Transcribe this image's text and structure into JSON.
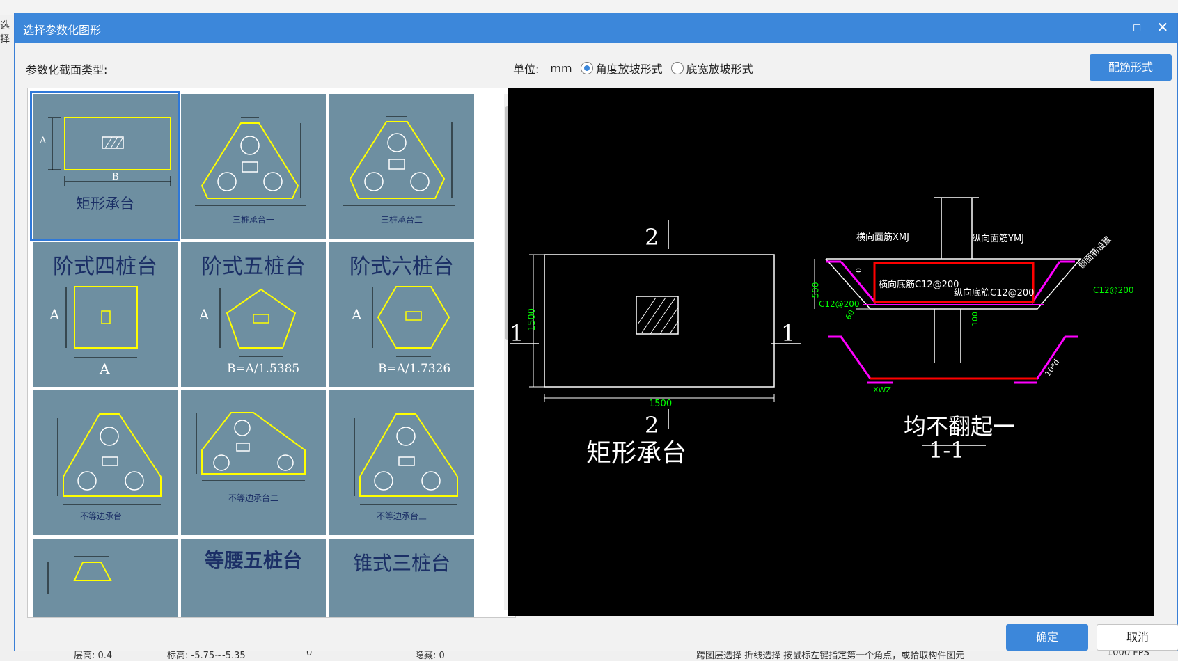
{
  "dialog": {
    "title": "选择参数化图形",
    "section_label": "参数化截面类型:",
    "unit_label": "单位:",
    "unit_value": "mm",
    "radio_options": [
      {
        "label": "角度放坡形式",
        "selected": true
      },
      {
        "label": "底宽放坡形式",
        "selected": false
      }
    ],
    "rebar_button": "配筋形式",
    "ok_button": "确定",
    "cancel_button": "取消"
  },
  "gallery": {
    "items": [
      {
        "caption": "矩形承台",
        "dim_a": "A",
        "dim_b": "B",
        "selected": true
      },
      {
        "caption": "三桩承台一"
      },
      {
        "caption": "三桩承台二"
      },
      {
        "caption": "阶式四桩台",
        "dim_a": "A",
        "dim_b": "A"
      },
      {
        "caption": "阶式五桩台",
        "dim_a": "A",
        "formula": "B=A/1.5385"
      },
      {
        "caption": "阶式六桩台",
        "dim_a": "A",
        "formula": "B=A/1.7326"
      },
      {
        "caption": "不等边承台一"
      },
      {
        "caption": "不等边承台二"
      },
      {
        "caption": "不等边承台三"
      },
      {
        "caption": ""
      },
      {
        "caption": "等腰五桩台"
      },
      {
        "caption": "锥式三桩台"
      }
    ]
  },
  "preview": {
    "plan": {
      "name": "矩形承台",
      "width": "1500",
      "height": "1500",
      "section_mark_h": "1",
      "section_mark_v": "2"
    },
    "section": {
      "title": "均不翻起一",
      "label": "1-1",
      "labels": {
        "h_top": "横向面筋XMJ",
        "v_top": "纵向面筋YMJ",
        "h_bottom": "横向底筋C12@200",
        "v_bottom": "纵向底筋C12@200",
        "left_rebar": "C12@200",
        "right_rebar": "C12@200",
        "side_note": "侧面筋设置",
        "depth": "500",
        "zero": "0",
        "cover": "100",
        "ten_d": "10*d",
        "xwz": "XWZ",
        "angle": "60"
      }
    }
  },
  "background": {
    "side_text": "选择",
    "status": {
      "floor_height": "层高: 0.4",
      "elevation": "标高: -5.75~-5.35",
      "zero": "0",
      "hidden": "隐藏: 0",
      "hint": "跨图层选择  折线选择  按鼠标左键指定第一个角点，或拾取构件图元",
      "fps": "1000 FPS"
    }
  },
  "colors": {
    "accent": "#3c87da",
    "thumb_bg": "#6e8fa1",
    "cad_yellow": "#ffff00",
    "cad_green": "#00ff00",
    "cad_red": "#ff0000",
    "cad_magenta": "#ff00ff"
  }
}
